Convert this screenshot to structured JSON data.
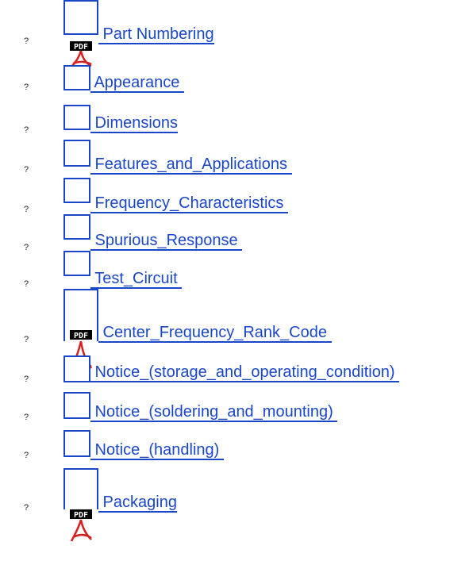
{
  "bullet_glyph": "?",
  "link_color": "#1a47c8",
  "items": [
    {
      "label": " Part Numbering",
      "icon": "pdf-icon"
    },
    {
      "label": " Appearance ",
      "icon": "image-icon"
    },
    {
      "label": " Dimensions",
      "icon": "image-icon"
    },
    {
      "label": " Features_and_Applications ",
      "icon": "document-icon"
    },
    {
      "label": " Frequency_Characteristics ",
      "icon": "image-icon"
    },
    {
      "label": " Spurious_Response ",
      "icon": "image-icon"
    },
    {
      "label": " Test_Circuit ",
      "icon": "image-icon"
    },
    {
      "label": " Center_Frequency_Rank_Code ",
      "icon": "pdf-icon"
    },
    {
      "label": " Notice_(storage_and_operating_condition) ",
      "icon": "document-icon"
    },
    {
      "label": " Notice_(soldering_and_mounting) ",
      "icon": "document-icon"
    },
    {
      "label": " Notice_(handling) ",
      "icon": "document-icon"
    },
    {
      "label": " Packaging",
      "icon": "pdf-icon"
    }
  ]
}
